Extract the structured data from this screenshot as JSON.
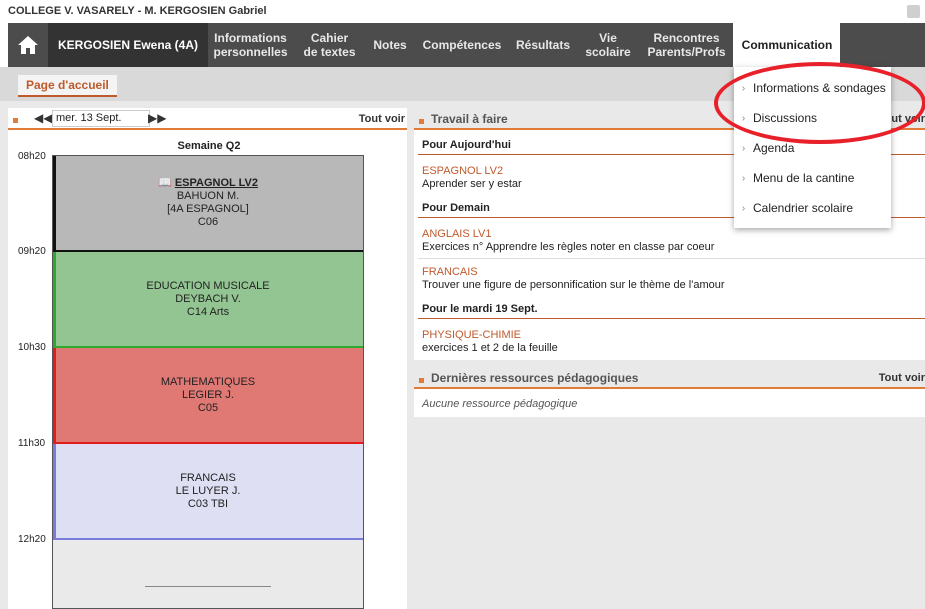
{
  "window": {
    "title": "COLLEGE V. VASARELY - M. KERGOSIEN Gabriel"
  },
  "nav": {
    "student": "KERGOSIEN Ewena (4A)",
    "items": [
      {
        "line1": "Informations",
        "line2": "personnelles"
      },
      {
        "line1": "Cahier",
        "line2": "de textes"
      },
      {
        "line1": "Notes",
        "line2": ""
      },
      {
        "line1": "Compétences",
        "line2": ""
      },
      {
        "line1": "Résultats",
        "line2": ""
      },
      {
        "line1": "Vie",
        "line2": "scolaire"
      },
      {
        "line1": "Rencontres",
        "line2": "Parents/Profs"
      }
    ],
    "active": "Communication"
  },
  "subnav": {
    "tab": "Page d'accueil"
  },
  "timetable": {
    "date": "mer. 13 Sept.",
    "view_all": "Tout voir",
    "week": "Semaine Q2",
    "times": [
      "08h20",
      "09h20",
      "10h30",
      "11h30",
      "12h20"
    ],
    "courses": [
      {
        "subject": "ESPAGNOL LV2",
        "teacher": "BAHUON M.",
        "group": "[4A ESPAGNOL]",
        "room": "C06",
        "color": "#b8b8b8",
        "bar": "#111111"
      },
      {
        "subject": "EDUCATION MUSICALE",
        "teacher": "DEYBACH V.",
        "group": "",
        "room": "C14 Arts",
        "color": "#93c593",
        "bar": "#2ea82e"
      },
      {
        "subject": "MATHEMATIQUES",
        "teacher": "LEGIER J.",
        "group": "",
        "room": "C05",
        "color": "#e07874",
        "bar": "#e21c1c"
      },
      {
        "subject": "FRANCAIS",
        "teacher": "LE LUYER J.",
        "group": "",
        "room": "C03 TBI",
        "color": "#dedff3",
        "bar": "#7b7bdc"
      }
    ]
  },
  "homework": {
    "title": "Travail à faire",
    "view_all": "Tout voir",
    "groups": [
      {
        "label": "Pour Aujourd'hui",
        "tasks": [
          {
            "subject": "ESPAGNOL LV2",
            "text": "Aprender ser y estar"
          }
        ]
      },
      {
        "label": "Pour Demain",
        "tasks": [
          {
            "subject": "ANGLAIS LV1",
            "text": "Exercices n° Apprendre les règles noter en classe par coeur"
          },
          {
            "subject": "FRANCAIS",
            "text": "Trouver une figure de personnification sur le thème de l'amour"
          }
        ]
      },
      {
        "label": "Pour le mardi 19 Sept.",
        "tasks": [
          {
            "subject": "PHYSIQUE-CHIMIE",
            "text": "exercices 1 et 2 de la feuille"
          }
        ]
      }
    ]
  },
  "resources": {
    "title": "Dernières ressources pédagogiques",
    "view_all": "Tout voir",
    "empty": "Aucune ressource pédagogique"
  },
  "dropdown": {
    "items": [
      "Informations & sondages",
      "Discussions",
      "Agenda",
      "Menu de la cantine",
      "Calendrier scolaire"
    ]
  }
}
